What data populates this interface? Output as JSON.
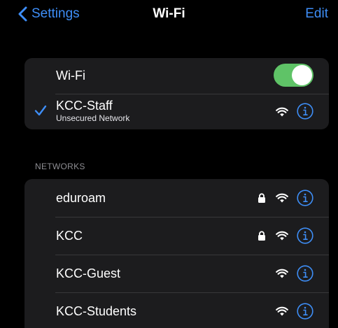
{
  "nav": {
    "back_label": "Settings",
    "title": "Wi-Fi",
    "edit_label": "Edit"
  },
  "wifi_toggle": {
    "label": "Wi-Fi",
    "on": true,
    "color": "#5fc367"
  },
  "current_network": {
    "name": "KCC-Staff",
    "status": "Unsecured Network",
    "connected": true
  },
  "networks_header": "NETWORKS",
  "networks": [
    {
      "name": "eduroam",
      "secured": true
    },
    {
      "name": "KCC",
      "secured": true
    },
    {
      "name": "KCC-Guest",
      "secured": false
    },
    {
      "name": "KCC-Students",
      "secured": false
    }
  ],
  "icons": {
    "back": "chevron-left-icon",
    "check": "checkmark-icon",
    "wifi": "wifi-icon",
    "lock": "lock-icon",
    "info": "info-icon"
  },
  "colors": {
    "accent": "#3e8ef7",
    "background": "#000000",
    "group": "#1c1c1e",
    "toggle_on": "#5fc367"
  }
}
